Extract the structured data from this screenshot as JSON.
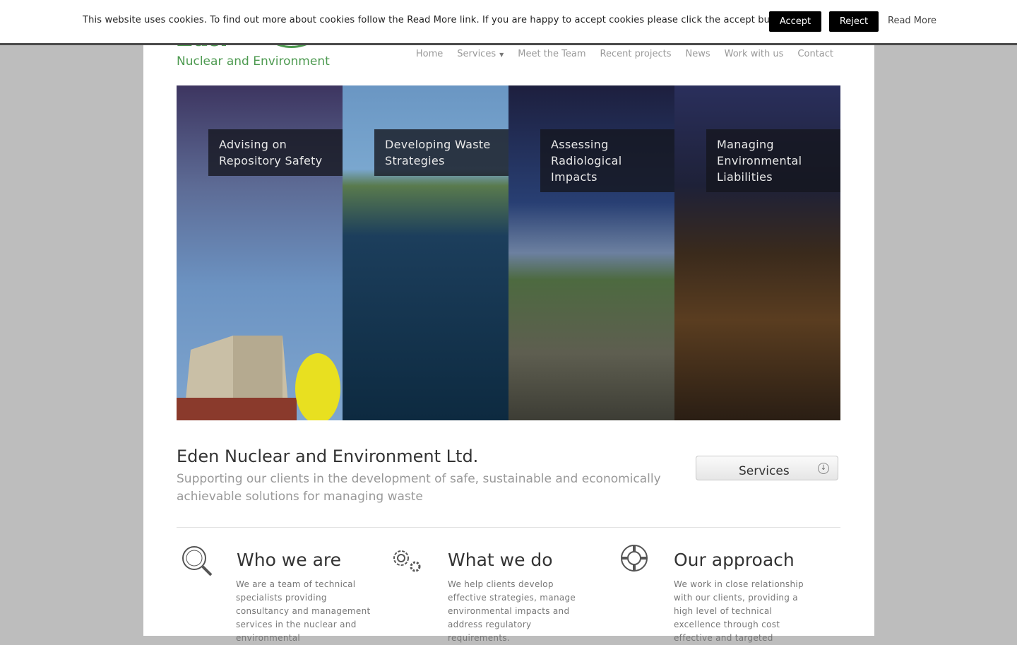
{
  "cookie": {
    "message": "This website uses cookies. To find out more about cookies follow the Read More link. If you are happy to accept cookies please click the accept button.",
    "accept_label": "Accept",
    "reject_label": "Reject",
    "read_more_label": "Read More"
  },
  "header": {
    "logo_word": "Eden",
    "logo_tagline": "Nuclear and Environment",
    "nav": [
      {
        "label": "Home"
      },
      {
        "label": "Services"
      },
      {
        "label": "Meet the Team"
      },
      {
        "label": "Recent projects"
      },
      {
        "label": "News"
      },
      {
        "label": "Work with us"
      },
      {
        "label": "Contact"
      }
    ]
  },
  "slider": {
    "panels": [
      {
        "caption": "Advising on Repository Safety"
      },
      {
        "caption": "Developing Waste Strategies"
      },
      {
        "caption": "Assessing Radiological Impacts"
      },
      {
        "caption": "Managing Environmental Liabilities"
      }
    ]
  },
  "intro": {
    "title": "Eden Nuclear and Environment Ltd.",
    "subtitle": "Supporting our clients in the development of safe, sustainable and economically achievable solutions for managing waste",
    "services_button": "Services"
  },
  "features": [
    {
      "icon": "magnifier-icon",
      "title": "Who we are",
      "text": "We are a team of technical specialists providing consultancy and management services in the nuclear and environmental"
    },
    {
      "icon": "gears-icon",
      "title": "What we do",
      "text": "We help clients develop effective strategies, manage environmental impacts and address regulatory requirements."
    },
    {
      "icon": "lifebuoy-icon",
      "title": "Our approach",
      "text": "We work in close relationship with our clients, providing a high level of technical excellence through cost effective and targeted"
    }
  ],
  "colors": {
    "brand_green": "#4d9a50",
    "page_background": "#bdbdbd",
    "button_black": "#000000"
  }
}
